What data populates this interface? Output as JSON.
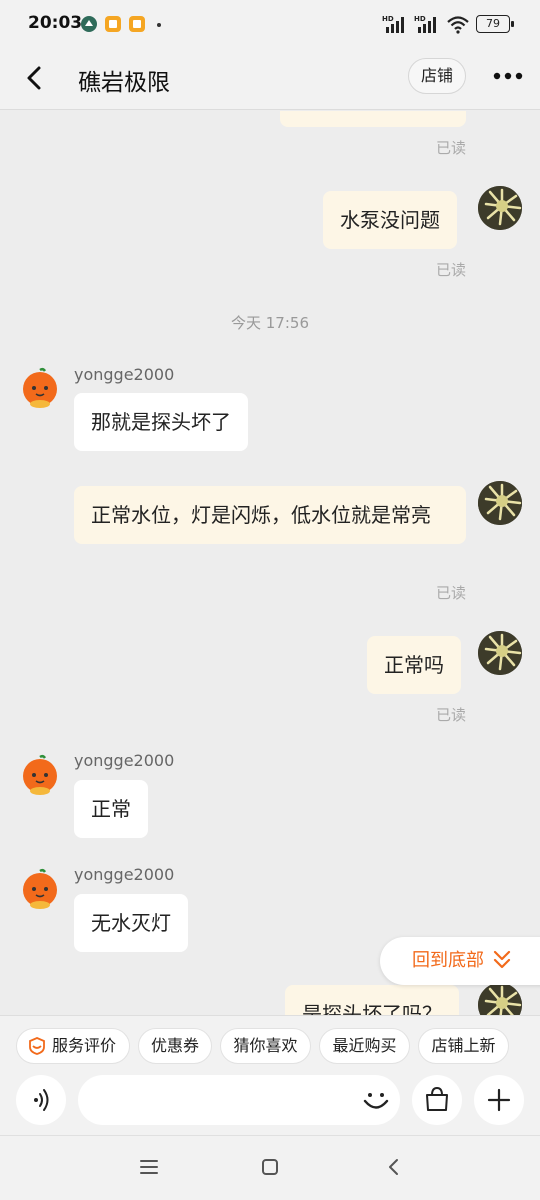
{
  "status_bar": {
    "time": "20:03",
    "battery": "79",
    "signal1": "HD",
    "signal2": "HD"
  },
  "header": {
    "title": "礁岩极限",
    "store_label": "店铺"
  },
  "chat": {
    "read_label": "已读",
    "date_label": "今天  17:56",
    "messages": [
      {
        "from": "me",
        "text": "水泵没问题"
      },
      {
        "from": "them",
        "user": "yongge2000",
        "text": "那就是探头坏了"
      },
      {
        "from": "me",
        "text": "正常水位，灯是闪烁，低水位就是常亮"
      },
      {
        "from": "me",
        "text": "正常吗"
      },
      {
        "from": "them",
        "user": "yongge2000",
        "text": "正常"
      },
      {
        "from": "them",
        "user": "yongge2000",
        "text": "无水灭灯"
      },
      {
        "from": "me",
        "text": "是探头坏了吗？"
      }
    ],
    "scroll_to_bottom": "回到底部"
  },
  "quick_bar": {
    "chips": [
      "服务评价",
      "优惠券",
      "猜你喜欢",
      "最近购买",
      "店铺上新"
    ]
  },
  "colors": {
    "accent": "#f26a1b",
    "my_bubble": "#fdf6e6",
    "background": "#ededed"
  }
}
